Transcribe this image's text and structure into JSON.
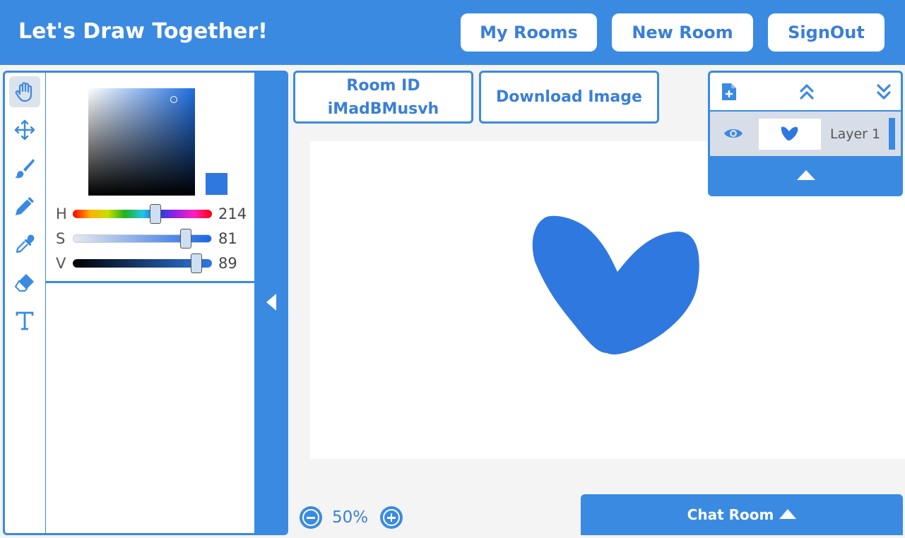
{
  "header": {
    "title": "Let's Draw Together!",
    "my_rooms": "My Rooms",
    "new_room": "New Room",
    "sign_out": "SignOut"
  },
  "tools": [
    {
      "name": "hand",
      "icon": "hand-icon",
      "active": true
    },
    {
      "name": "move",
      "icon": "move-arrows-icon",
      "active": false
    },
    {
      "name": "brush",
      "icon": "paintbrush-icon",
      "active": false
    },
    {
      "name": "pencil",
      "icon": "pencil-icon",
      "active": false
    },
    {
      "name": "eyedropper",
      "icon": "eyedropper-icon",
      "active": false
    },
    {
      "name": "eraser",
      "icon": "eraser-icon",
      "active": false
    },
    {
      "name": "text",
      "icon": "text-t-icon",
      "active": false
    }
  ],
  "color_picker": {
    "current_color": "#2f78e0",
    "h": {
      "label": "H",
      "value": "214",
      "fraction": 0.594
    },
    "s": {
      "label": "S",
      "value": "81",
      "fraction": 0.81
    },
    "v": {
      "label": "V",
      "value": "89",
      "fraction": 0.89
    }
  },
  "room": {
    "label": "Room ID",
    "id": "iMadBMusvh",
    "download": "Download Image"
  },
  "zoom": {
    "value": "50%",
    "minus_icon": "zoom-out-icon",
    "plus_icon": "zoom-in-icon"
  },
  "chat": {
    "label": "Chat Room"
  },
  "layers": {
    "add_icon": "new-layer-icon",
    "up_icon": "chevrons-up-icon",
    "down_icon": "chevrons-down-icon",
    "items": [
      {
        "name": "Layer 1",
        "visible": true
      }
    ]
  },
  "colors": {
    "accent": "#3a8ae2",
    "text_accent": "#3a7fd6",
    "heart": "#2f78e0"
  }
}
